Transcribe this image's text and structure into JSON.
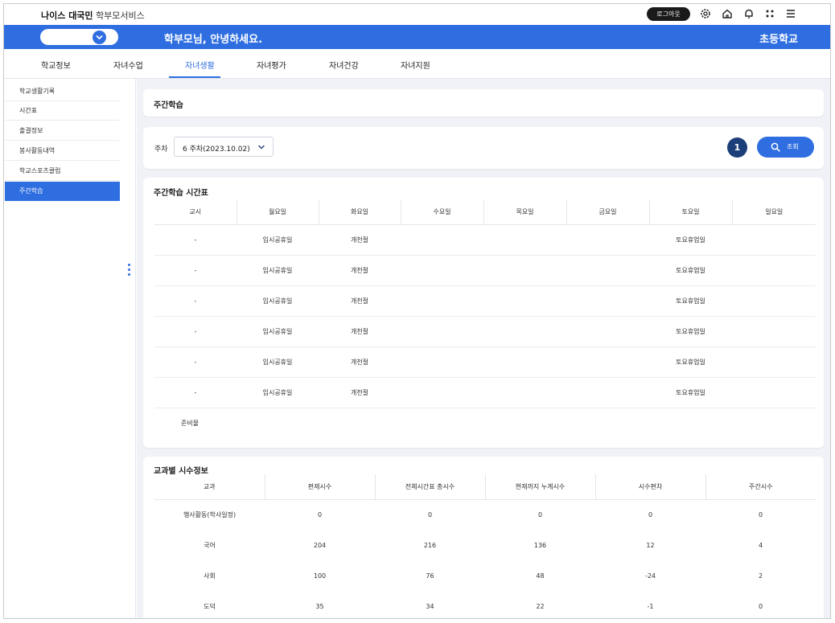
{
  "header": {
    "brand_bold": "나이스 대국민",
    "brand_rest": "학부모서비스",
    "logout_label": "로그아웃",
    "icons": [
      "gear-icon",
      "home-icon",
      "bell-icon",
      "apps-icon",
      "menu-icon"
    ]
  },
  "banner": {
    "greeting": "학부모님, 안녕하세요.",
    "school": "초등학교",
    "accent": "#2e6ee0"
  },
  "mainmenu": {
    "items": [
      "학교정보",
      "자녀수업",
      "자녀생활",
      "자녀평가",
      "자녀건강",
      "자녀지원"
    ],
    "active": "자녀생활"
  },
  "sidebar": {
    "items": [
      "학교생활기록",
      "시간표",
      "출결정보",
      "봉사활동내역",
      "학교스포츠클럽",
      "주간학습"
    ],
    "active": "주간학습"
  },
  "page": {
    "title": "주간학습"
  },
  "search": {
    "week_label": "주차",
    "week_value": "6 주차(2023.10.02)",
    "badge": "1",
    "search_label": "조회"
  },
  "timetable": {
    "title": "주간학습 시간표",
    "headers": [
      "교시",
      "월요일",
      "화요일",
      "수요일",
      "목요일",
      "금요일",
      "토요일",
      "일요일"
    ],
    "rows": [
      [
        "-",
        "임시공휴일",
        "개천절",
        "",
        "",
        "",
        "토요휴업일",
        ""
      ],
      [
        "-",
        "임시공휴일",
        "개천절",
        "",
        "",
        "",
        "토요휴업일",
        ""
      ],
      [
        "-",
        "임시공휴일",
        "개천절",
        "",
        "",
        "",
        "토요휴업일",
        ""
      ],
      [
        "-",
        "임시공휴일",
        "개천절",
        "",
        "",
        "",
        "토요휴업일",
        ""
      ],
      [
        "-",
        "임시공휴일",
        "개천절",
        "",
        "",
        "",
        "토요휴업일",
        ""
      ],
      [
        "-",
        "임시공휴일",
        "개천절",
        "",
        "",
        "",
        "토요휴업일",
        ""
      ]
    ],
    "prep_label": "준비물"
  },
  "subjects": {
    "title": "교과별 시수정보",
    "headers": [
      "교과",
      "편제시수",
      "전체시간표 총시수",
      "현재까지 누계시수",
      "시수편차",
      "주간시수"
    ],
    "rows": [
      [
        "행사활동(학사일정)",
        "0",
        "0",
        "0",
        "0",
        "0"
      ],
      [
        "국어",
        "204",
        "216",
        "136",
        "12",
        "4"
      ],
      [
        "사회",
        "100",
        "76",
        "48",
        "-24",
        "2"
      ],
      [
        "도덕",
        "35",
        "34",
        "22",
        "-1",
        "0"
      ]
    ]
  }
}
